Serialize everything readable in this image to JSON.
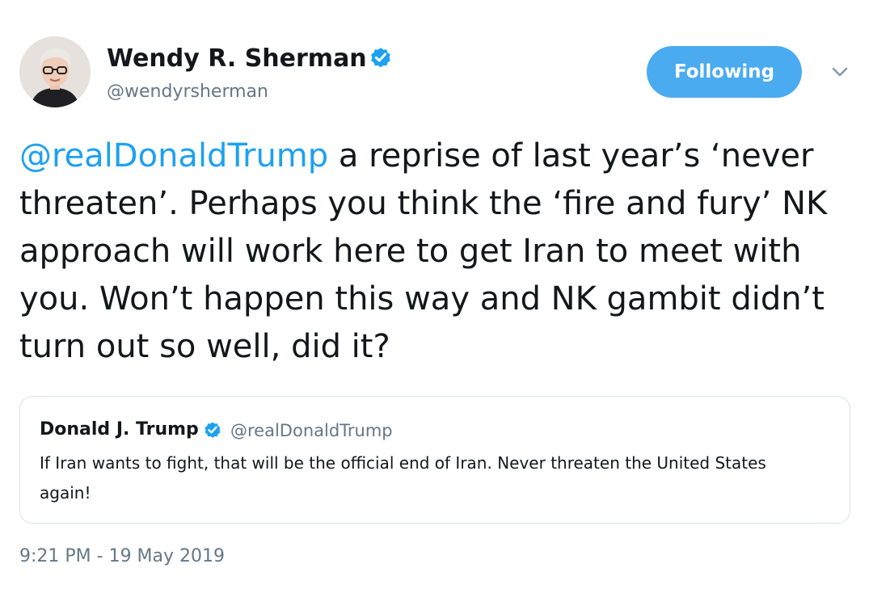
{
  "author": {
    "display_name": "Wendy R. Sherman",
    "handle": "@wendyrsherman",
    "verified": true,
    "avatar_icon": "profile-photo"
  },
  "follow_button": {
    "label": "Following",
    "color": "#4aabf0"
  },
  "menu": {
    "icon": "chevron-down-icon"
  },
  "tweet": {
    "mention": "@realDonaldTrump",
    "text": " a reprise of last year’s ‘never threaten’. Perhaps you think the ‘fire and fury’ NK approach will work here to get Iran to meet with you. Won’t happen this way and NK gambit didn’t turn out so well, did it?"
  },
  "quoted_tweet": {
    "display_name": "Donald J. Trump",
    "handle": "@realDonaldTrump",
    "verified": true,
    "text": "If Iran wants to fight, that will be the official end of Iran. Never threaten the United States again!"
  },
  "timestamp": "9:21 PM - 19 May 2019",
  "colors": {
    "link": "#1da1f2",
    "secondary_text": "#657786",
    "verified_badge": "#1da1f2",
    "border": "#dbe2e8"
  }
}
